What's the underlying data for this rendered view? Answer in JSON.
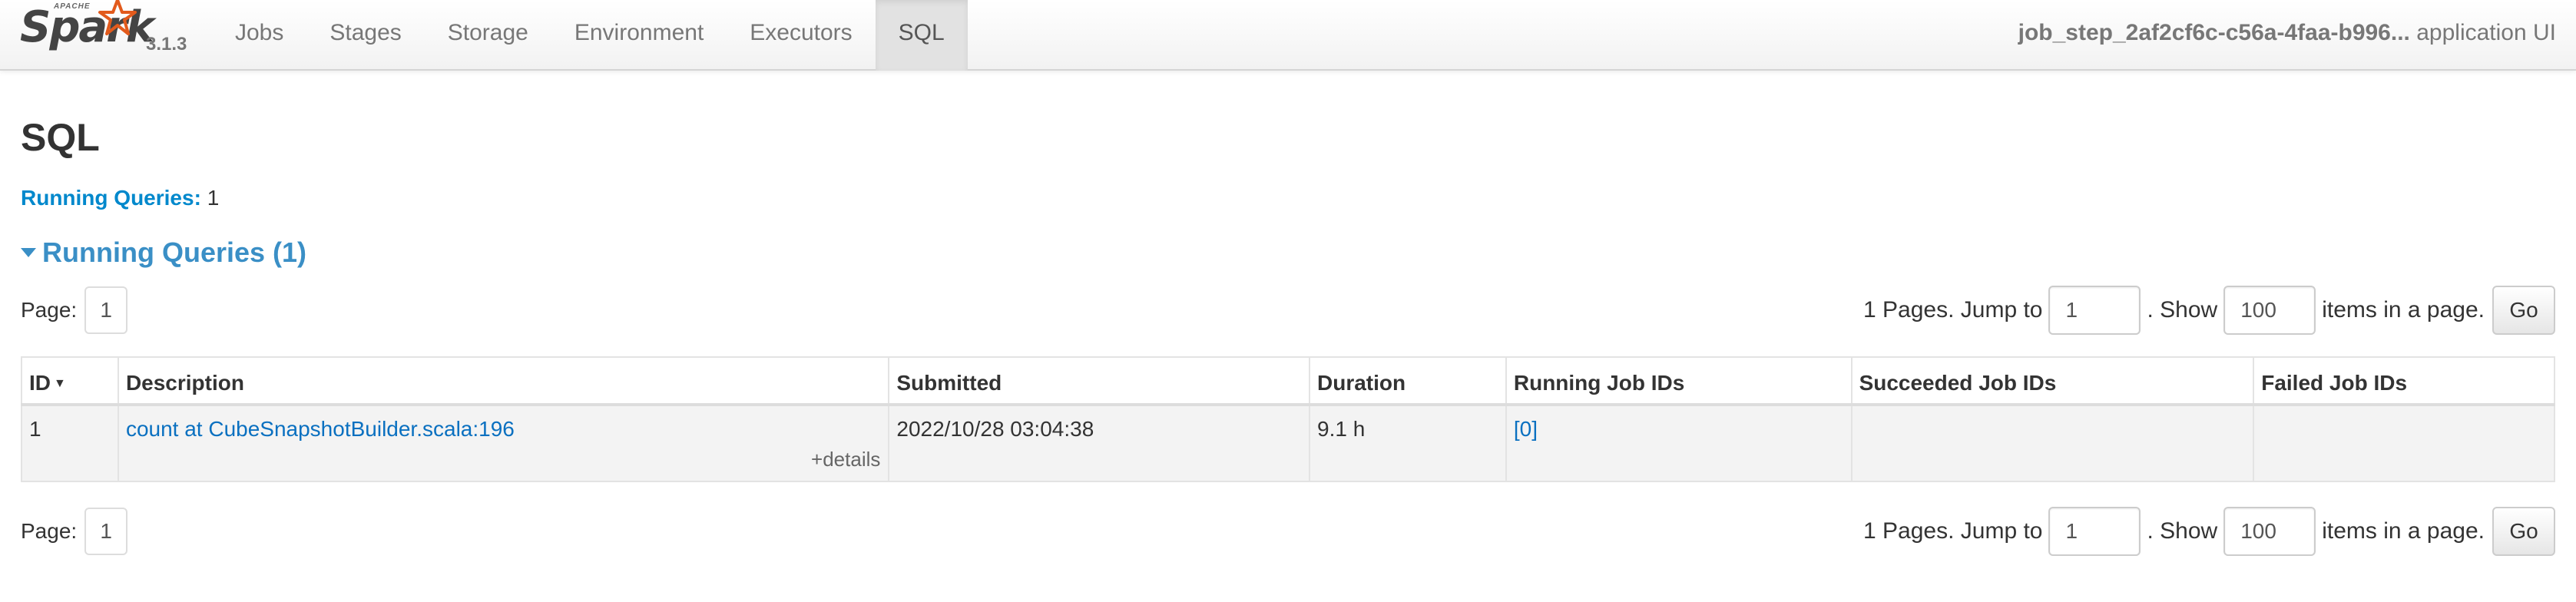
{
  "brand": {
    "apache": "APACHE",
    "name": "Spark",
    "version": "3.1.3",
    "star_color": "#e25a1c"
  },
  "nav": {
    "items": [
      {
        "label": "Jobs",
        "active": false
      },
      {
        "label": "Stages",
        "active": false
      },
      {
        "label": "Storage",
        "active": false
      },
      {
        "label": "Environment",
        "active": false
      },
      {
        "label": "Executors",
        "active": false
      },
      {
        "label": "SQL",
        "active": true
      }
    ],
    "app_name": "job_step_2af2cf6c-c56a-4faa-b996...",
    "app_suffix": "application UI"
  },
  "page": {
    "title": "SQL",
    "summary_label": "Running Queries:",
    "summary_value": "1",
    "section_title": "Running Queries (1)"
  },
  "pager": {
    "page_label": "Page:",
    "current_page": "1",
    "pages_text": "1 Pages. Jump to",
    "jump_value": "1",
    "show_text": ". Show",
    "page_size": "100",
    "items_text": "items in a page.",
    "go_label": "Go"
  },
  "table": {
    "headers": [
      "ID",
      "Description",
      "Submitted",
      "Duration",
      "Running Job IDs",
      "Succeeded Job IDs",
      "Failed Job IDs"
    ],
    "sort_indicator": "▼",
    "rows": [
      {
        "id": "1",
        "description": "count at CubeSnapshotBuilder.scala:196",
        "details": "+details",
        "submitted": "2022/10/28 03:04:38",
        "duration": "9.1 h",
        "running_job_ids": "[0]",
        "succeeded_job_ids": "",
        "failed_job_ids": ""
      }
    ]
  },
  "colors": {
    "link": "#0a70c0",
    "accent": "#3a8fc6",
    "summary_label": "#0088cc"
  }
}
